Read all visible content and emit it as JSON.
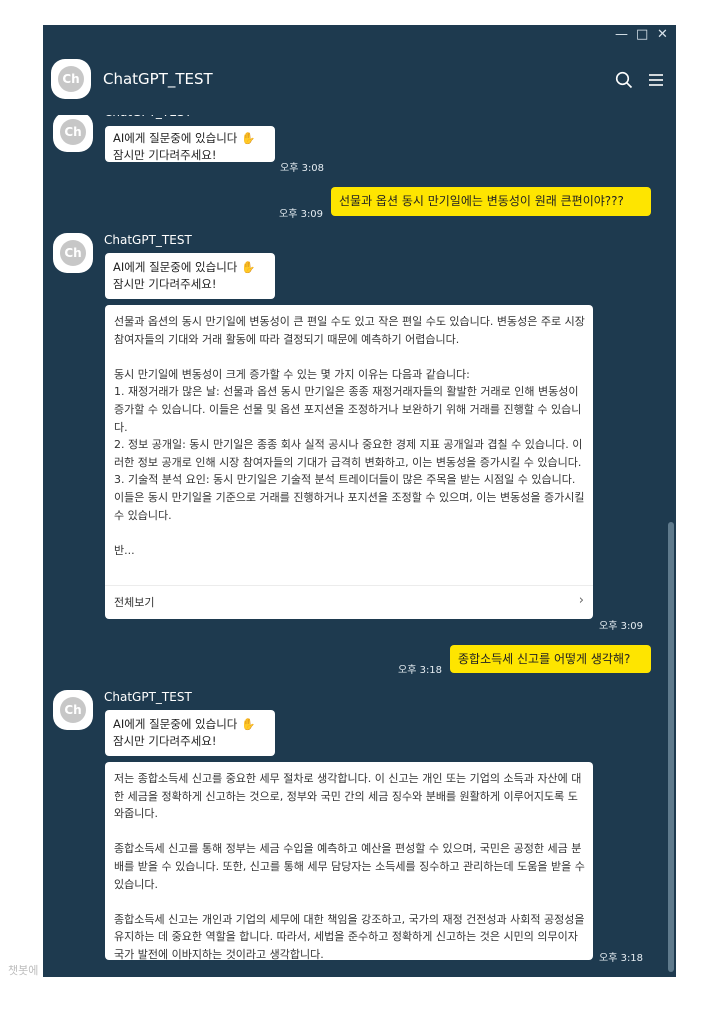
{
  "window": {
    "minimize": "—",
    "maximize": "□",
    "close": "✕",
    "title": "ChatGPT_TEST",
    "avatar_text": "Ch"
  },
  "messages": {
    "m1": {
      "sender": "ChatGPT_TEST",
      "line1": "AI에게 질문중에 있습니다 ✋",
      "line2": "잠시만 기다려주세요!",
      "time": "오후 3:08"
    },
    "m2": {
      "text": "선물과 옵션 동시 만기일에는 변동성이 원래 큰편이야???",
      "time": "오후 3:09"
    },
    "m3": {
      "sender": "ChatGPT_TEST",
      "line1": "AI에게 질문중에 있습니다 ✋",
      "line2": "잠시만 기다려주세요!",
      "body": "선물과 옵션의 동시 만기일에 변동성이 큰 편일 수도 있고 작은 편일 수도 있습니다. 변동성은 주로 시장 참여자들의 기대와 거래 활동에 따라 결정되기 때문에 예측하기 어렵습니다.\n\n동시 만기일에 변동성이 크게 증가할 수 있는 몇 가지 이유는 다음과 같습니다:\n1. 재정거래가 많은 날: 선물과 옵션 동시 만기일은 종종 재정거래자들의 활발한 거래로 인해 변동성이 증가할 수 있습니다. 이들은 선물 및 옵션 포지션을 조정하거나 보완하기 위해 거래를 진행할 수 있습니다.\n2. 정보 공개일: 동시 만기일은 종종 회사 실적 공시나 중요한 경제 지표 공개일과 겹칠 수 있습니다. 이러한 정보 공개로 인해 시장 참여자들의 기대가 급격히 변화하고, 이는 변동성을 증가시킬 수 있습니다.\n3. 기술적 분석 요인: 동시 만기일은 기술적 분석 트레이더들이 많은 주목을 받는 시점일 수 있습니다. 이들은 동시 만기일을 기준으로 거래를 진행하거나 포지션을 조정할 수 있으며, 이는 변동성을 증가시킬 수 있습니다.\n\n반...",
      "view_all": "전체보기",
      "time": "오후 3:09"
    },
    "m4": {
      "text": "종합소득세 신고를 어떻게 생각해?",
      "time": "오후 3:18"
    },
    "m5": {
      "sender": "ChatGPT_TEST",
      "line1": "AI에게 질문중에 있습니다 ✋",
      "line2": "잠시만 기다려주세요!",
      "body": "저는 종합소득세 신고를 중요한 세무 절차로 생각합니다. 이 신고는 개인 또는 기업의 소득과 자산에 대한 세금을 정확하게 신고하는 것으로, 정부와 국민 간의 세금 징수와 분배를 원활하게 이루어지도록 도와줍니다.\n\n종합소득세 신고를 통해 정부는 세금 수입을 예측하고 예산을 편성할 수 있으며, 국민은 공정한 세금 분배를 받을 수 있습니다. 또한, 신고를 통해 세무 담당자는 소득세를 징수하고 관리하는데 도움을 받을 수 있습니다.\n\n종합소득세 신고는 개인과 기업의 세무에 대한 책임을 강조하고, 국가의 재정 건전성과 사회적 공정성을 유지하는 데 중요한 역할을 합니다. 따라서, 세법을 준수하고 정확하게 신고하는 것은 시민의 의무이자 국가 발전에 이바지하는 것이라고 생각합니다.",
      "time": "오후 3:18"
    }
  },
  "watermark": "챗봇에",
  "colors": {
    "window_bg": "#1e3a4f",
    "user_bubble": "#fee500",
    "bot_bubble": "#ffffff"
  },
  "icons": [
    "search-icon",
    "menu-icon",
    "chevron-right-icon"
  ]
}
